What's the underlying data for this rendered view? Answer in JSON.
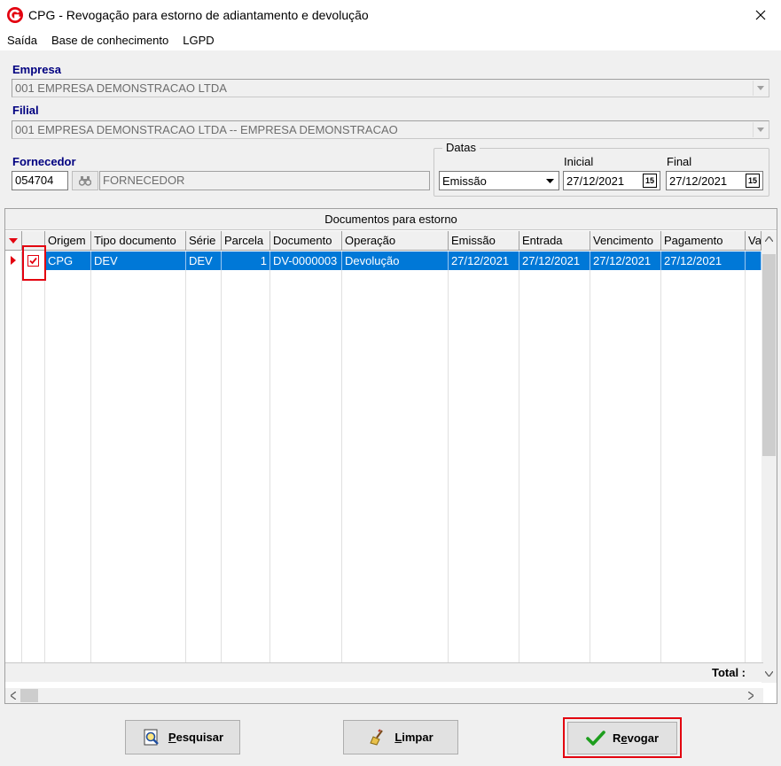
{
  "window": {
    "title": "CPG - Revogação para estorno de adiantamento e devolução"
  },
  "menu": [
    "Saída",
    "Base de conhecimento",
    "LGPD"
  ],
  "form": {
    "empresa": {
      "label": "Empresa",
      "value": "001 EMPRESA DEMONSTRACAO LTDA"
    },
    "filial": {
      "label": "Filial",
      "value": "001 EMPRESA DEMONSTRACAO LTDA -- EMPRESA DEMONSTRACAO"
    },
    "fornecedor": {
      "label": "Fornecedor",
      "code": "054704",
      "name": "FORNECEDOR"
    },
    "datas": {
      "title": "Datas",
      "tipo": "Emissão",
      "inicial_label": "Inicial",
      "inicial": "27/12/2021",
      "final_label": "Final",
      "final": "27/12/2021",
      "cal_icon": "15"
    }
  },
  "grid": {
    "caption": "Documentos para estorno",
    "columns": [
      "",
      "",
      "Origem",
      "Tipo documento",
      "Série",
      "Parcela",
      "Documento",
      "Operação",
      "Emissão",
      "Entrada",
      "Vencimento",
      "Pagamento",
      "Va"
    ],
    "rows": [
      {
        "origem": "CPG",
        "tipo": "DEV",
        "serie": "DEV",
        "parcela": "1",
        "documento": "DV-0000003",
        "operacao": "Devolução",
        "emissao": "27/12/2021",
        "entrada": "27/12/2021",
        "vencimento": "27/12/2021",
        "pagamento": "27/12/2021",
        "checked": true
      }
    ],
    "total_label": "Total :"
  },
  "buttons": {
    "pesquisar": {
      "first": "P",
      "rest": "esquisar"
    },
    "limpar": {
      "first": "L",
      "rest": "impar"
    },
    "revogar": {
      "first": "R",
      "mid": "e",
      "rest": "vogar"
    }
  },
  "colors": {
    "accent_red": "#e3000f",
    "selection": "#0078d7",
    "label_blue": "#000080"
  }
}
